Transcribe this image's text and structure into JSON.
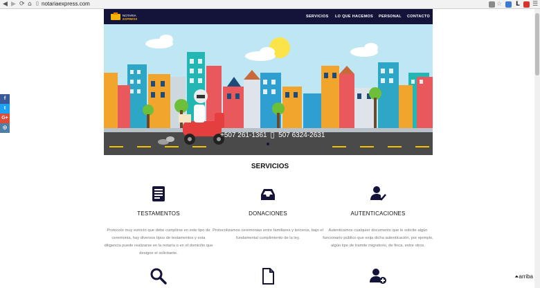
{
  "browser": {
    "url": "notariaexpress.com"
  },
  "navbar": {
    "logo_alt": "NOTARIA EXPRESS",
    "items": [
      {
        "label": "SERVICIOS"
      },
      {
        "label": "LO QUE HACEMOS"
      },
      {
        "label": "PERSONAL"
      },
      {
        "label": "CONTACTO"
      }
    ]
  },
  "hero": {
    "phone1": "+507 261-1361",
    "phone2": "507 6324-2631"
  },
  "social": [
    {
      "icon": "facebook-icon",
      "glyph": "f",
      "color": "#3b5998"
    },
    {
      "icon": "twitter-icon",
      "glyph": "t",
      "color": "#1da1f2"
    },
    {
      "icon": "google-plus-icon",
      "glyph": "G+",
      "color": "#dd4b39"
    },
    {
      "icon": "instagram-icon",
      "glyph": "◎",
      "color": "#517fa4"
    }
  ],
  "services": {
    "title": "SERVICIOS",
    "items": [
      {
        "name": "TESTAMENTOS",
        "icon": "document-list-icon",
        "desc": "Protocolo muy estricto que debe cumplirse en este tipo de ceremonia, hay diversos tipos de testamentos y esta diligencia puede realizarse en la notaría o en el domicilio que designe el solicitante."
      },
      {
        "name": "DONACIONES",
        "icon": "inbox-icon",
        "desc": "Protocolizamos ceremonias entre familiares y terceros, bajo el fundamental cumplimiento de la ley."
      },
      {
        "name": "AUTENTICACIONES",
        "icon": "user-check-icon",
        "desc": "Autenticamos cualquier documento que le solicite algún funcionario público que exija dicha autenticación, por ejemplo, algún tipo de tramite migratorio, de finca, entre otros."
      },
      {
        "name": "",
        "icon": "search-icon",
        "desc": ""
      },
      {
        "name": "",
        "icon": "file-icon",
        "desc": ""
      },
      {
        "name": "",
        "icon": "user-add-icon",
        "desc": ""
      }
    ]
  },
  "back_to_top": {
    "label": "arriba"
  },
  "colors": {
    "navy": "#14143a",
    "sky": "#bfe7f3",
    "road": "#4a4a4a"
  }
}
